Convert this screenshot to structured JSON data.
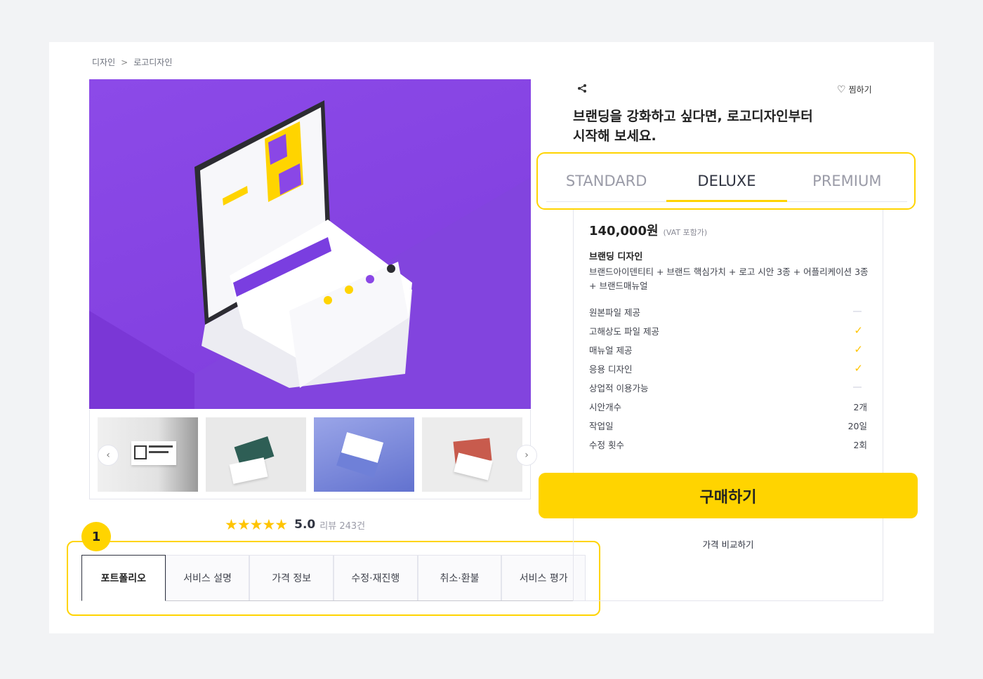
{
  "breadcrumb": {
    "root": "디자인",
    "separator": ">",
    "current": "로고디자인"
  },
  "gallery": {
    "prev_icon": "‹",
    "next_icon": "›"
  },
  "rating": {
    "stars": "★★★★★",
    "score": "5.0",
    "reviews": "리뷰 243건"
  },
  "tabs_badge": "1",
  "tabs": [
    {
      "label": "포트폴리오"
    },
    {
      "label": "서비스 설명"
    },
    {
      "label": "가격 정보"
    },
    {
      "label": "수정·재진행"
    },
    {
      "label": "취소·환불"
    },
    {
      "label": "서비스 평가"
    }
  ],
  "header": {
    "share_icon": "share-icon",
    "favorite_label": "찜하기",
    "title": "브랜딩을 강화하고 싶다면, 로고디자인부터 시작해 보세요."
  },
  "packages": [
    {
      "label": "STANDARD"
    },
    {
      "label": "DELUXE"
    },
    {
      "label": "PREMIUM"
    }
  ],
  "selected_package": {
    "price": "140,000원",
    "vat": "(VAT 포함가)",
    "name": "브랜딩 디자인",
    "description": "브랜드아이덴티티 + 브랜드 핵심가치 + 로고 시안 3종 + 어플리케이션 3종 + 브랜드매뉴얼",
    "features": [
      {
        "label": "원본파일 제공",
        "value": ""
      },
      {
        "label": "고해상도 파일 제공",
        "value": "✓"
      },
      {
        "label": "매뉴얼 제공",
        "value": "✓"
      },
      {
        "label": "응용 디자인",
        "value": "✓"
      },
      {
        "label": "상업적 이용가능",
        "value": ""
      },
      {
        "label": "시안개수",
        "value": "2개"
      },
      {
        "label": "작업일",
        "value": "20일"
      },
      {
        "label": "수정 횟수",
        "value": "2회"
      }
    ]
  },
  "actions": {
    "buy_label": "구매하기",
    "compare_label": "가격 비교하기"
  },
  "colors": {
    "accent": "#ffd400",
    "hero_bg": "#8a47e6"
  }
}
